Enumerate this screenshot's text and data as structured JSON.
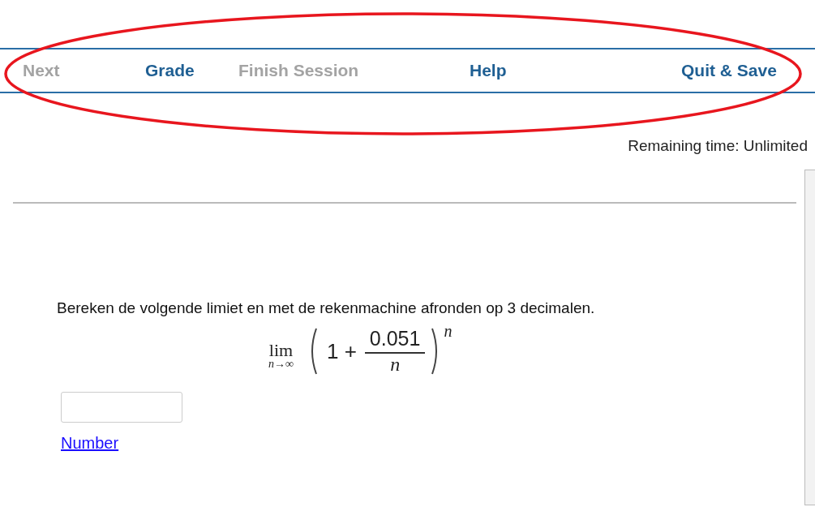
{
  "nav": [
    {
      "label": "Next",
      "disabled": true
    },
    {
      "label": "Grade",
      "disabled": false
    },
    {
      "label": "Finish Session",
      "disabled": true
    },
    {
      "label": "Help",
      "disabled": false
    },
    {
      "label": "Quit & Save",
      "disabled": false
    }
  ],
  "remaining_time": "Remaining time: Unlimited",
  "question": {
    "text": "Bereken de volgende limiet en met de rekenmachine afronden op 3 decimalen.",
    "formula": {
      "operator": "lim",
      "limit": "n→∞",
      "base": "1 +",
      "numerator": "0.051",
      "denominator": "n",
      "exponent": "n"
    },
    "hint_link": "Number"
  }
}
